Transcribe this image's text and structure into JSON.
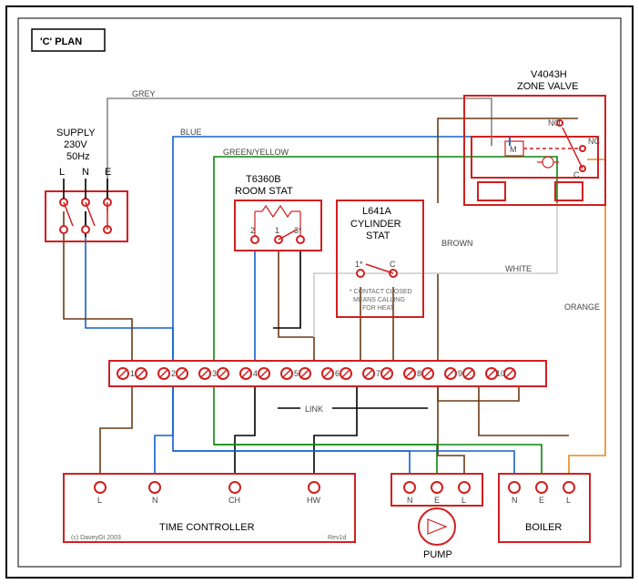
{
  "title": "'C' PLAN",
  "supply": {
    "label": "SUPPLY",
    "voltage": "230V",
    "freq": "50Hz",
    "terms": [
      "L",
      "N",
      "E"
    ]
  },
  "room_stat": {
    "model": "T6360B",
    "name": "ROOM STAT",
    "terms": [
      "2",
      "1",
      "3*"
    ]
  },
  "cyl_stat": {
    "model": "L641A",
    "name": "CYLINDER",
    "name2": "STAT",
    "terms": [
      "1*",
      "C"
    ],
    "note1": "* CONTACT CLOSED",
    "note2": "MEANS CALLING",
    "note3": "FOR HEAT"
  },
  "zone_valve": {
    "model": "V4043H",
    "name": "ZONE VALVE",
    "motor": "M",
    "no": "NO",
    "nc": "NC",
    "c": "C"
  },
  "junction": {
    "terms": [
      "1",
      "2",
      "3",
      "4",
      "5",
      "6",
      "7",
      "8",
      "9",
      "10"
    ],
    "link": "LINK"
  },
  "time_ctl": {
    "name": "TIME CONTROLLER",
    "terms": [
      "L",
      "N",
      "CH",
      "HW"
    ],
    "rev": "Rev1d",
    "copy": "(c) DaveyGt 2003"
  },
  "pump": {
    "name": "PUMP",
    "terms": [
      "N",
      "E",
      "L"
    ]
  },
  "boiler": {
    "name": "BOILER",
    "terms": [
      "N",
      "E",
      "L"
    ]
  },
  "wire_labels": {
    "grey": "GREY",
    "blue": "BLUE",
    "green": "GREEN/YELLOW",
    "brown": "BROWN",
    "white": "WHITE",
    "orange": "ORANGE"
  }
}
